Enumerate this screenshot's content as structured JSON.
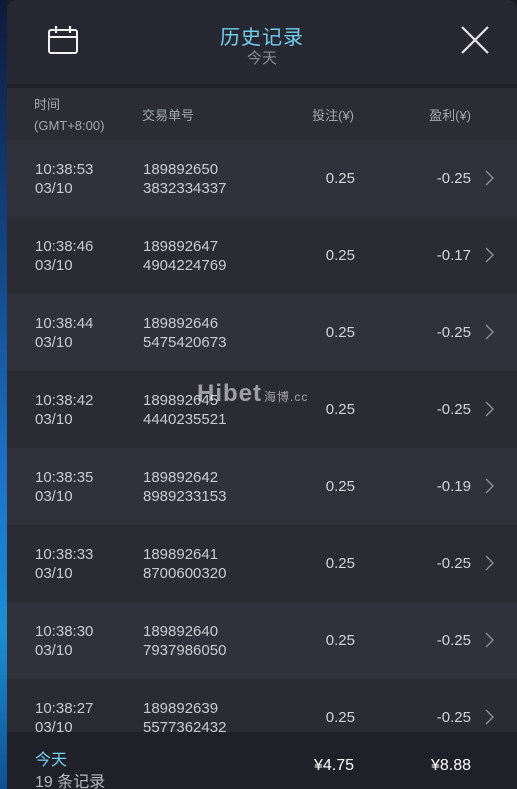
{
  "header": {
    "title": "历史记录",
    "subtitle": "今天"
  },
  "columns": {
    "time_line1": "时间",
    "time_line2": "(GMT+8:00)",
    "order": "交易单号",
    "bet": "投注(¥)",
    "profit": "盈利(¥)"
  },
  "rows": [
    {
      "time": "10:38:53",
      "date": "03/10",
      "order1": "189892650",
      "order2": "3832334337",
      "bet": "0.25",
      "profit": "-0.25"
    },
    {
      "time": "10:38:46",
      "date": "03/10",
      "order1": "189892647",
      "order2": "4904224769",
      "bet": "0.25",
      "profit": "-0.17"
    },
    {
      "time": "10:38:44",
      "date": "03/10",
      "order1": "189892646",
      "order2": "5475420673",
      "bet": "0.25",
      "profit": "-0.25"
    },
    {
      "time": "10:38:42",
      "date": "03/10",
      "order1": "189892645",
      "order2": "4440235521",
      "bet": "0.25",
      "profit": "-0.25"
    },
    {
      "time": "10:38:35",
      "date": "03/10",
      "order1": "189892642",
      "order2": "8989233153",
      "bet": "0.25",
      "profit": "-0.19"
    },
    {
      "time": "10:38:33",
      "date": "03/10",
      "order1": "189892641",
      "order2": "8700600320",
      "bet": "0.25",
      "profit": "-0.25"
    },
    {
      "time": "10:38:30",
      "date": "03/10",
      "order1": "189892640",
      "order2": "7937986050",
      "bet": "0.25",
      "profit": "-0.25"
    },
    {
      "time": "10:38:27",
      "date": "03/10",
      "order1": "189892639",
      "order2": "5577362432",
      "bet": "0.25",
      "profit": "-0.25"
    }
  ],
  "footer": {
    "label": "今天",
    "count": "19 条记录",
    "total_bet": "¥4.75",
    "total_profit": "¥8.88"
  },
  "watermark": {
    "brand": "Hibet",
    "suffix": "海博.cc"
  },
  "icons": {
    "left": "calendar-icon",
    "right": "close-icon",
    "row": "chevron-right-icon"
  },
  "colors": {
    "accent": "#6fd0f2",
    "panel": "#2a2b33",
    "footer": "#1f2028"
  }
}
